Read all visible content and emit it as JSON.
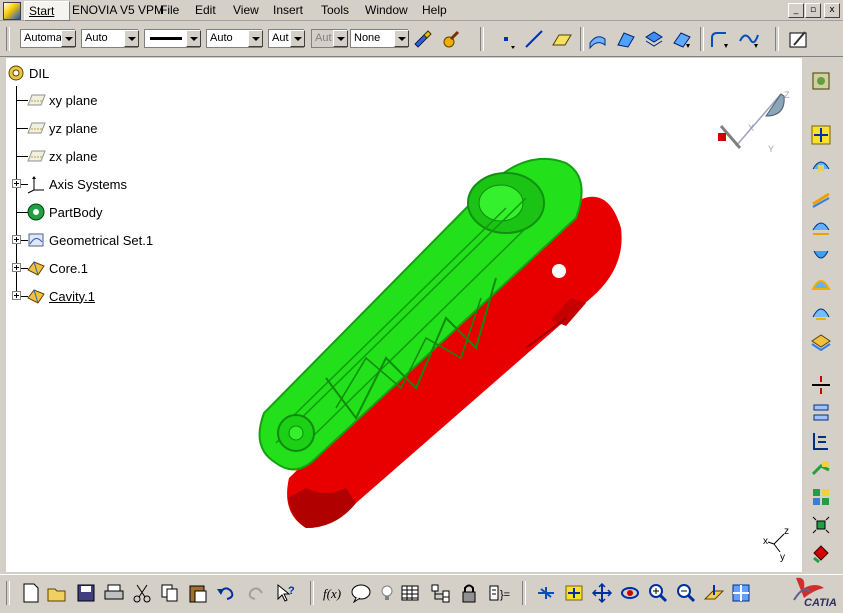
{
  "menubar": {
    "start": "Start",
    "items": [
      "ENOVIA V5 VPM",
      "File",
      "Edit",
      "View",
      "Insert",
      "Tools",
      "Window",
      "Help"
    ],
    "window_buttons": [
      "_",
      "▫",
      "x"
    ]
  },
  "props_toolbar": {
    "color_combo": "Automa",
    "transparency_combo": "Auto",
    "linetype_combo": "",
    "thickness_combo": "Auto",
    "point_combo": "Aut",
    "layer_disabled_combo": "Aut",
    "layer_combo": "None"
  },
  "tree": {
    "root": "DIL",
    "items": [
      {
        "label": "xy plane",
        "icon": "plane-icon"
      },
      {
        "label": "yz plane",
        "icon": "plane-icon"
      },
      {
        "label": "zx plane",
        "icon": "plane-icon"
      },
      {
        "label": "Axis Systems",
        "icon": "axis-system-icon"
      },
      {
        "label": "PartBody",
        "icon": "partbody-icon"
      },
      {
        "label": "Geometrical Set.1",
        "icon": "geometrical-set-icon"
      },
      {
        "label": "Core.1",
        "icon": "core-icon"
      },
      {
        "label": "Cavity.1",
        "icon": "cavity-icon"
      }
    ]
  },
  "compass": {
    "labels": [
      "Z",
      "X",
      "Y"
    ]
  },
  "axis_triad": {
    "labels": [
      "z",
      "x",
      "y"
    ]
  },
  "colors": {
    "core_part": "#22e11b",
    "cavity_part": "#e80000",
    "viewport_bg": "#ffffff",
    "ui_bg": "#d4d0c8"
  },
  "logo": {
    "text": "CATIA"
  }
}
